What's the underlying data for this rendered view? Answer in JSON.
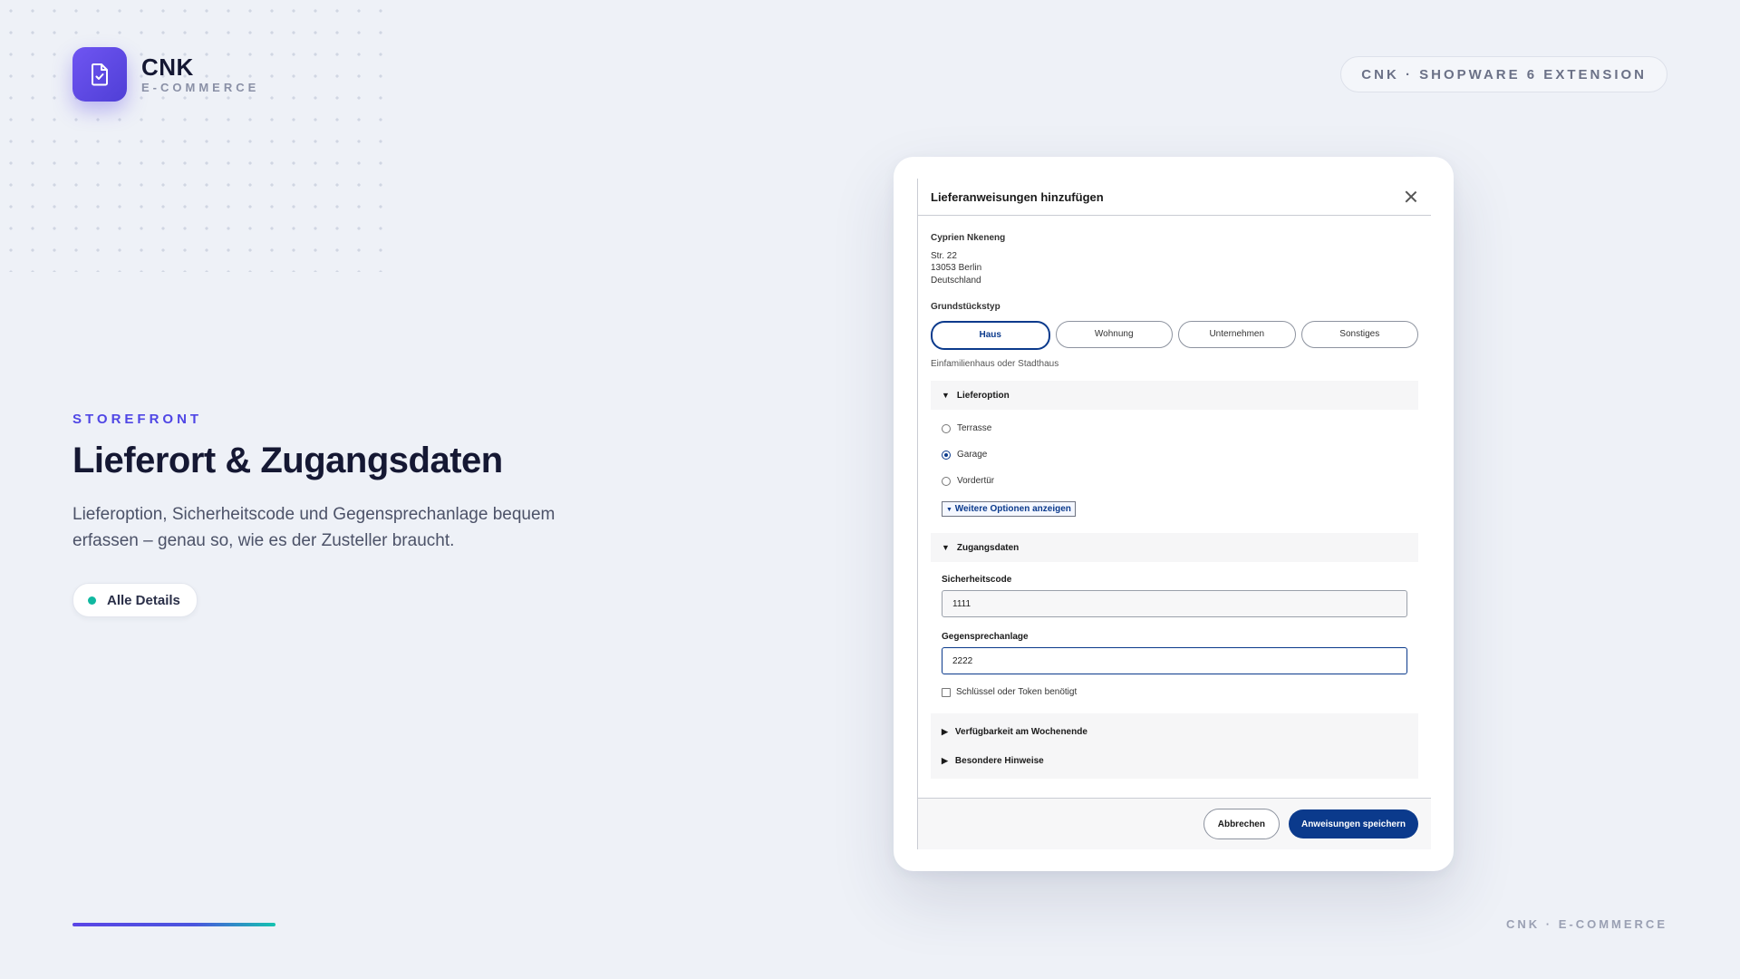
{
  "brand": {
    "name": "CNK",
    "subtitle": "E-COMMERCE",
    "logo_icon": "document-check-icon",
    "accent": "#5b47e8"
  },
  "top_pill": "CNK · SHOPWARE 6 EXTENSION",
  "hero": {
    "eyebrow": "STOREFRONT",
    "title": "Lieferort & Zugangsdaten",
    "lead": "Lieferoption, Sicherheitscode und Gegensprechanlage bequem erfassen – genau so, wie es der Zusteller braucht.",
    "details_label": "Alle Details",
    "details_dot_color": "#10b8a0"
  },
  "footer": {
    "right_label": "CNK · E-COMMERCE"
  },
  "modal": {
    "title": "Lieferanweisungen hinzufügen",
    "address": {
      "name": "Cyprien Nkeneng",
      "street": "Str. 22",
      "city": "13053 Berlin",
      "country": "Deutschland"
    },
    "property_type": {
      "label": "Grundstückstyp",
      "options": [
        "Haus",
        "Wohnung",
        "Unternehmen",
        "Sonstiges"
      ],
      "selected": "Haus",
      "hint": "Einfamilienhaus oder Stadthaus"
    },
    "delivery_option": {
      "label": "Lieferoption",
      "options": [
        "Terrasse",
        "Garage",
        "Vordertür"
      ],
      "selected": "Garage",
      "more_label": "Weitere Optionen anzeigen"
    },
    "access": {
      "label": "Zugangsdaten",
      "security_code_label": "Sicherheitscode",
      "security_code_value": "1111",
      "intercom_label": "Gegensprechanlage",
      "intercom_value": "2222",
      "key_label": "Schlüssel oder Token benötigt"
    },
    "collapsed_sections": [
      "Verfügbarkeit am Wochenende",
      "Besondere Hinweise"
    ],
    "cancel_label": "Abbrechen",
    "save_label": "Anweisungen speichern",
    "primary_color": "#0b3a8c"
  }
}
